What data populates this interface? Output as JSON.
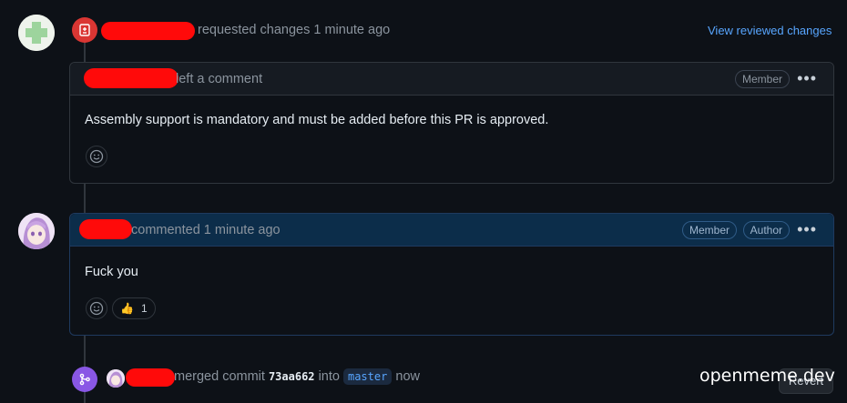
{
  "review_event": {
    "action_text": "requested changes 1 minute ago",
    "view_link": "View reviewed changes"
  },
  "comment1": {
    "action_text": "left a comment",
    "role_badge": "Member",
    "more_label": "•••",
    "body": "Assembly support is mandatory and must be added before this PR is approved."
  },
  "comment2": {
    "action_text": "commented 1 minute ago",
    "role_badge": "Member",
    "author_badge": "Author",
    "more_label": "•••",
    "body": "Fuck you",
    "reaction_emoji": "👍",
    "reaction_count": "1"
  },
  "merge_event": {
    "action_prefix": "merged commit",
    "commit_hash": "73aa662",
    "into_text": "into",
    "branch": "master",
    "time_text": "now",
    "revert_label": "Revert"
  },
  "watermark": "openmeme.dev",
  "colors": {
    "request_changes_red": "#da3633",
    "merge_purple": "#8957e5",
    "link_blue": "#58a6ff",
    "redaction_red": "#ff0a0a"
  }
}
